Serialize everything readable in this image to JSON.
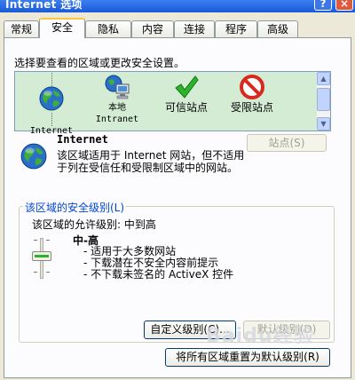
{
  "window": {
    "title": "Internet 选项",
    "help_label": "?",
    "close_label": "×"
  },
  "tabs": [
    {
      "label": "常规"
    },
    {
      "label": "安全"
    },
    {
      "label": "隐私"
    },
    {
      "label": "内容"
    },
    {
      "label": "连接"
    },
    {
      "label": "程序"
    },
    {
      "label": "高级"
    }
  ],
  "active_tab": "安全",
  "instruction": "选择要查看的区域或更改安全设置。",
  "zones": [
    {
      "label": "Internet",
      "icon": "globe-icon"
    },
    {
      "label": "本地\nIntranet",
      "icon": "network-computer-icon"
    },
    {
      "label": "可信站点",
      "icon": "green-checkmark-icon"
    },
    {
      "label": "受限站点",
      "icon": "red-prohibited-icon"
    }
  ],
  "selected_zone": {
    "title": "Internet",
    "description": "该区域适用于 Internet 网站，但不适用于列在受信任和受限制区域中的网站。",
    "sites_button": "站点(S)"
  },
  "security_level": {
    "group_label": "该区域的安全级别(L)",
    "allowed_label": "该区域的允许级别: 中到高",
    "level_name": "中-高",
    "bullets": [
      "- 适用于大多数网站",
      "- 下载潜在不安全内容前提示",
      "- 不下载未签名的 ActiveX 控件"
    ],
    "custom_button": "自定义级别(C)...",
    "default_button": "默认级别(D)",
    "reset_all_button": "将所有区域重置为默认级别(R)"
  },
  "watermark": "Baidu经验",
  "colors": {
    "accent": "#0046d5",
    "zone_bg": "#d4ecd4",
    "tab_highlight": "#ffc83c"
  }
}
